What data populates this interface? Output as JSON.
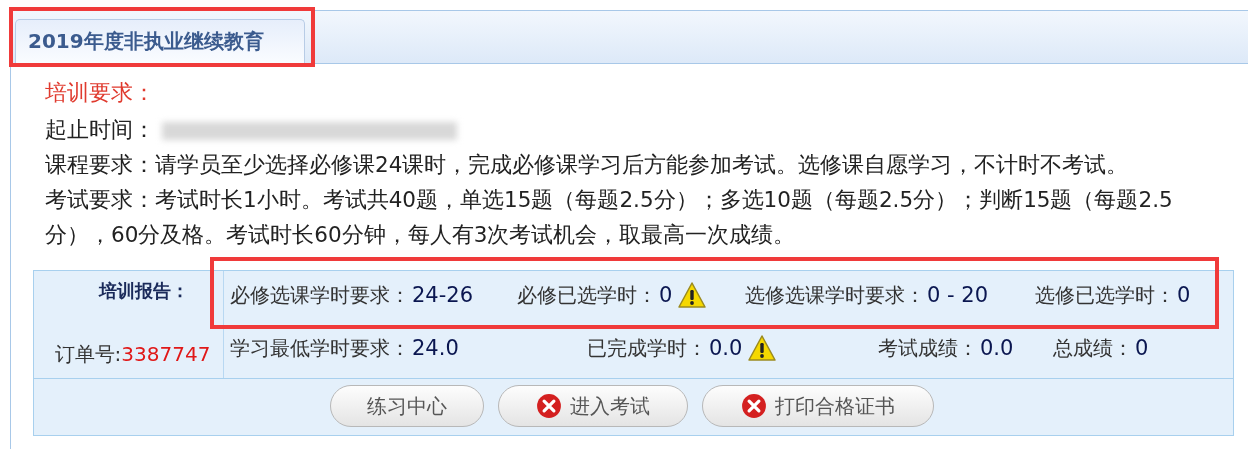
{
  "tab": {
    "title": "2019年度非执业继续教育",
    "highlighted": true
  },
  "requirements": {
    "heading": "培训要求：",
    "period_label": "起止时间：",
    "lines": [
      "课程要求：请学员至少选择必修课24课时，完成必修课学习后方能参加考试。选修课自愿学习，不计时不考试。",
      "考试要求：考试时长1小时。考试共40题，单选15题（每题2.5分）；多选10题（每题2.5分）；判断15题（每题2.5分），60分及格。考试时长60分钟，每人有3次考试机会，取最高一次成绩。"
    ]
  },
  "report": {
    "heading": "培训报告：",
    "order_label": "订单号:",
    "order_number": "3387747",
    "rows": [
      {
        "highlighted": true,
        "items": [
          {
            "label": "必修选课学时要求：",
            "value": "24-26",
            "warning": false
          },
          {
            "label": "必修已选学时：",
            "value": "0",
            "warning": true
          },
          {
            "label": "选修选课学时要求：",
            "value": "0 - 20",
            "warning": false
          },
          {
            "label": "选修已选学时：",
            "value": "0",
            "warning": false
          }
        ]
      },
      {
        "highlighted": false,
        "items": [
          {
            "label": "学习最低学时要求： ",
            "value": "24.0",
            "warning": false
          },
          {
            "label": "已完成学时： ",
            "value": "0.0",
            "warning": true
          },
          {
            "label": "考试成绩：",
            "value": "0.0",
            "warning": false
          },
          {
            "label": "总成绩：",
            "value": "0",
            "warning": false
          }
        ]
      }
    ],
    "buttons": [
      {
        "label": "练习中心",
        "kind": "plain"
      },
      {
        "label": "进入考试",
        "kind": "error"
      },
      {
        "label": "打印合格证书",
        "kind": "error"
      }
    ]
  }
}
